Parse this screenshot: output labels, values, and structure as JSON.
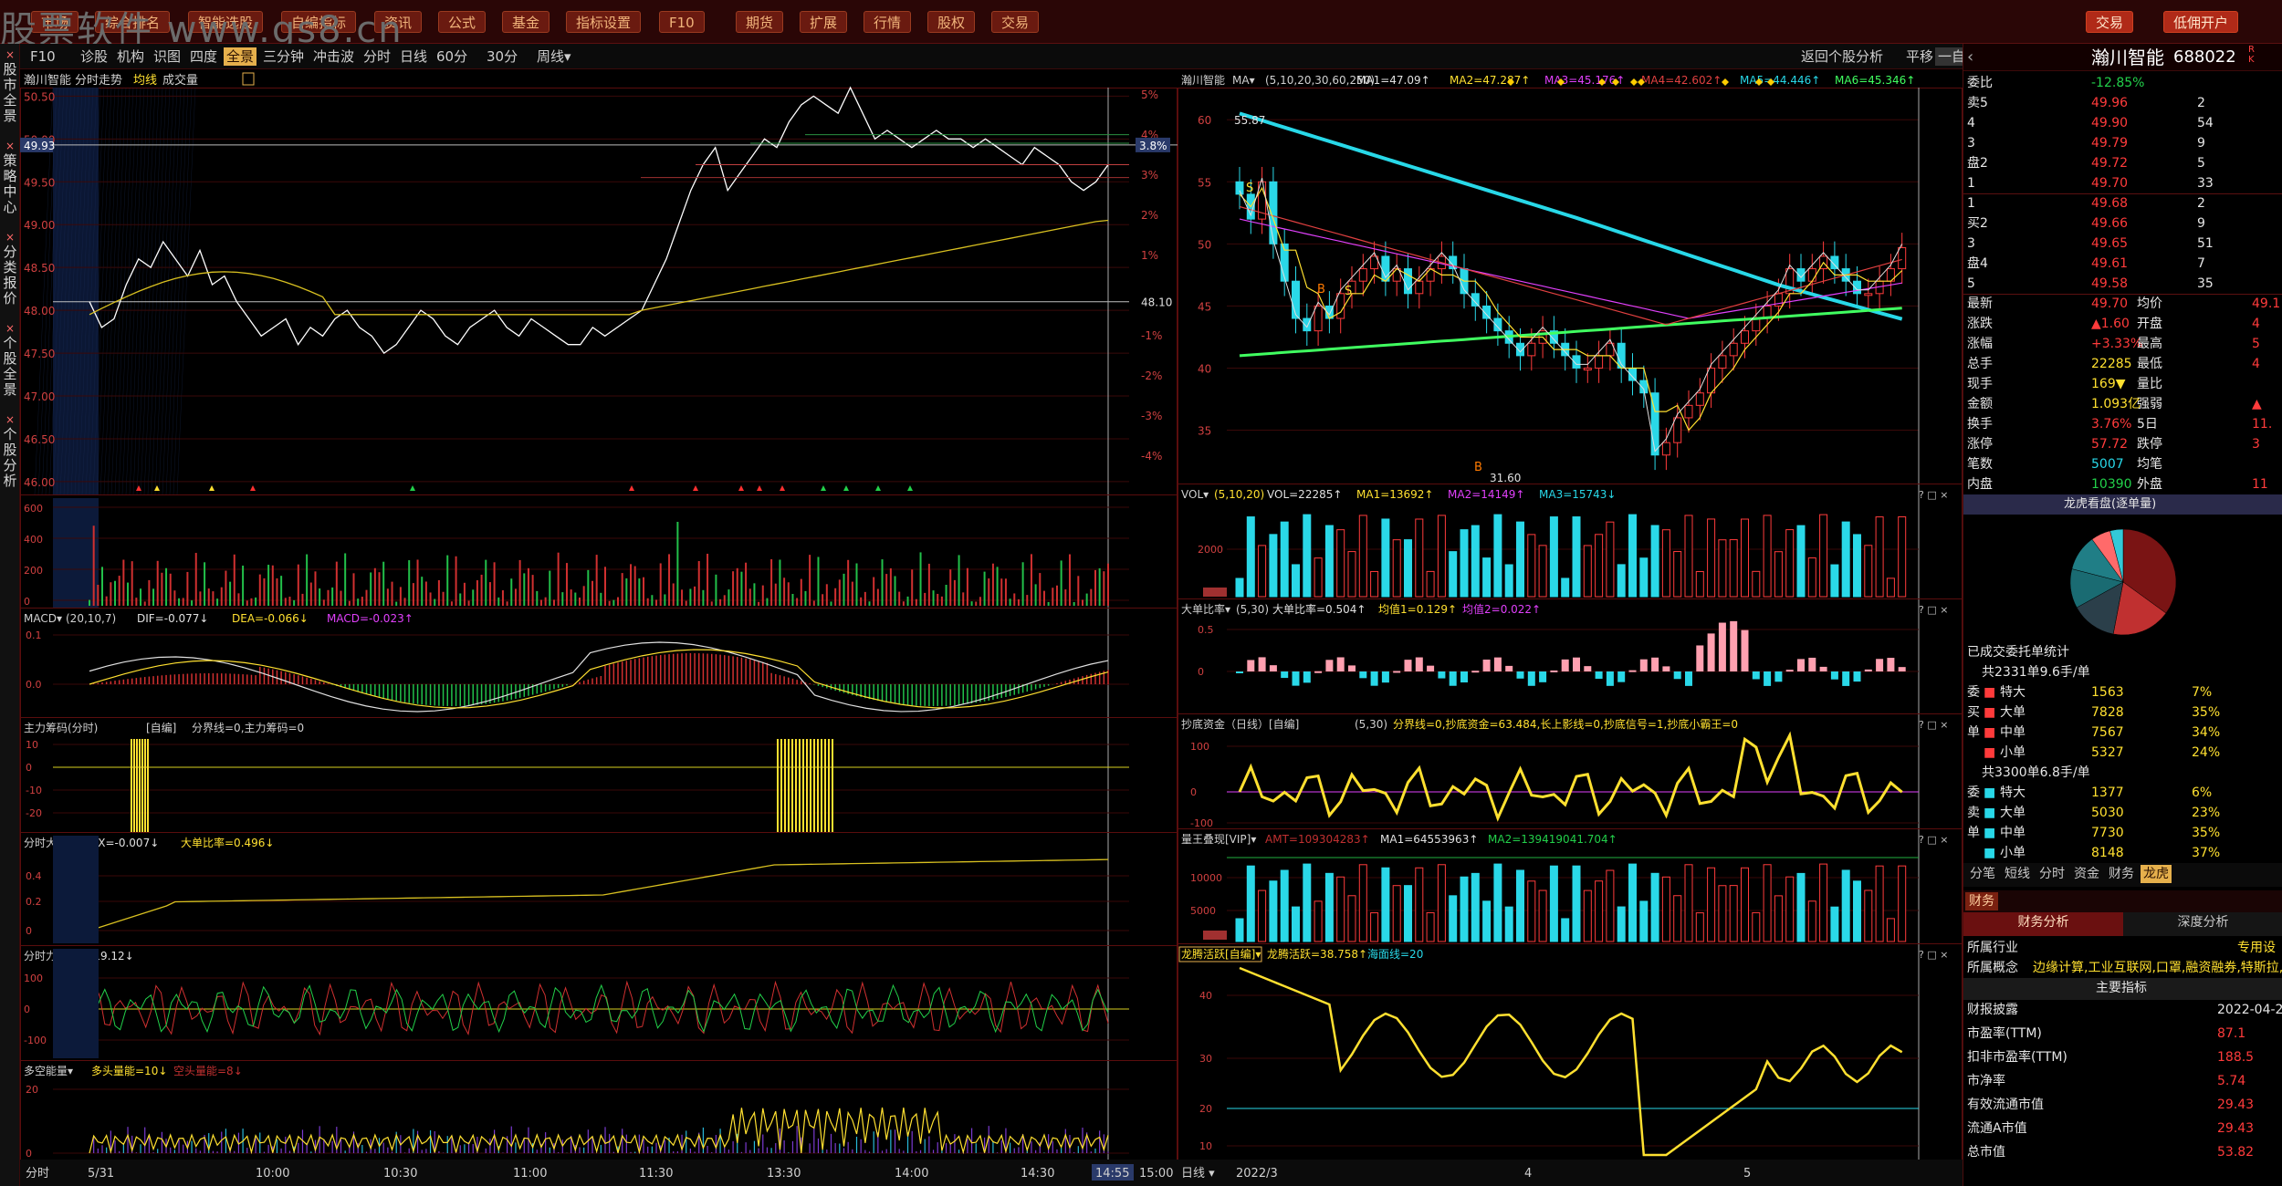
{
  "top": {
    "watermark": "股票软件 www.gs8.cn",
    "menu": [
      "市场",
      "综合排名",
      "智能选股",
      "自编指标",
      "资讯",
      "公式",
      "基金",
      "指标设置",
      "F10",
      "期货",
      "扩展",
      "行情",
      "股权",
      "交易"
    ],
    "trade": "交易",
    "open_account": "低佣开户"
  },
  "sidenav": [
    "股市全景",
    "策略中心",
    "分类报价",
    "个股全景",
    "个股分析"
  ],
  "tabs": [
    "F10",
    "诊股",
    "机构",
    "识图",
    "四度",
    "全景",
    "三分钟",
    "冲击波",
    "分时",
    "日线",
    "60分",
    "30分",
    "周线▾"
  ],
  "right_tabs": {
    "return": "返回个股分析",
    "flat": "平移",
    "select": "一自选"
  },
  "intraday": {
    "header": {
      "name": "瀚川智能",
      "mode": "分时走势",
      "avg": "均线",
      "vol": "成交量"
    },
    "price_ticks": [
      "50.50",
      "50.00",
      "49.50",
      "49.00",
      "48.50",
      "48.00",
      "47.50",
      "47.00",
      "46.50",
      "46.00"
    ],
    "pct_ticks": [
      "5%",
      "4%",
      "3%",
      "2%",
      "1%",
      "",
      "-1%",
      "-2%",
      "-3%",
      "-4%"
    ],
    "cursor_price": "49.93",
    "cursor_pct": "3.8%",
    "mid_label": "48.10",
    "time_ticks": [
      "分时",
      "5/31",
      "10:00",
      "10:30",
      "11:00",
      "11:30",
      "13:30",
      "14:00",
      "14:30",
      "14:55",
      "15:00"
    ],
    "vol_ticks": [
      "600",
      "400",
      "200",
      "0"
    ],
    "macd": {
      "name": "MACD",
      "params": "(20,10,7)",
      "dif": "DIF=-0.077",
      "dea": "DEA=-0.066",
      "macd": "MACD=-0.023"
    },
    "chip": {
      "name": "主力筹码(分时)",
      "mode": "[自编]",
      "text": "分界线=0,主力筹码=0"
    },
    "big": {
      "name": "分时大单",
      "dx": "DX=-0.007",
      "ratio": "大单比率=0.496"
    },
    "force": {
      "name": "分时力道",
      "val": "-19.12"
    },
    "energy": {
      "name": "多空能量",
      "long": "多头量能=10",
      "short": "空头量能=8"
    }
  },
  "daily": {
    "header": {
      "name": "瀚川智能",
      "ma": "MA",
      "params": "(5,10,20,30,60,250)",
      "ma1": "MA1=47.09",
      "ma2": "MA2=47.287",
      "ma3": "MA3=45.176",
      "ma4": "MA4=42.602",
      "ma5": "MA5=44.446",
      "ma6": "MA6=45.346"
    },
    "price_ticks": [
      "60",
      "55",
      "50",
      "45",
      "40",
      "35"
    ],
    "hi_label": "55.87",
    "lo_label": "31.60",
    "vol": {
      "name": "VOL",
      "params": "(5,10,20)",
      "v": "VOL=22285",
      "ma1": "MA1=13692",
      "ma2": "MA2=14149",
      "ma3": "MA3=15743"
    },
    "big": {
      "name": "大单比率",
      "params": "(5,30)",
      "v": "大单比率=0.504",
      "j1": "均值1=0.129",
      "j2": "均值2=0.022"
    },
    "bottom": {
      "name": "抄底资金（日线）[自编]",
      "params": "(5,30)",
      "text": "分界线=0,抄底资金=63.484,长上影线=0,抄底信号=1,抄底小霸王=0"
    },
    "amount": {
      "name": "量王叠现[VIP]",
      "amt": "AMT=109304283",
      "ma1": "MA1=64553963",
      "ma2": "MA2=139419041.704"
    },
    "active": {
      "name": "龙腾活跃[自编]",
      "v": "龙腾活跃=38.758",
      "line": "海面线=20"
    },
    "time_ticks": [
      "日线",
      "2022/3",
      "4",
      "5"
    ]
  },
  "quote": {
    "name": "瀚川智能",
    "code": "688022",
    "webi": {
      "label": "委比",
      "val": "-12.85%"
    },
    "sell": [
      {
        "l": "卖5",
        "p": "49.96",
        "v": "2"
      },
      {
        "l": "4",
        "p": "49.90",
        "v": "54"
      },
      {
        "l": "3",
        "p": "49.79",
        "v": "9"
      },
      {
        "l": "盘2",
        "p": "49.72",
        "v": "5"
      },
      {
        "l": "1",
        "p": "49.70",
        "v": "33"
      }
    ],
    "buy": [
      {
        "l": "1",
        "p": "49.68",
        "v": "2"
      },
      {
        "l": "买2",
        "p": "49.66",
        "v": "9"
      },
      {
        "l": "3",
        "p": "49.65",
        "v": "51"
      },
      {
        "l": "盘4",
        "p": "49.61",
        "v": "7"
      },
      {
        "l": "5",
        "p": "49.58",
        "v": "35"
      }
    ],
    "stats": [
      {
        "a": "最新",
        "b": "49.70",
        "c": "均价",
        "d": "49.1"
      },
      {
        "a": "涨跌",
        "b": "▲1.60",
        "c": "开盘",
        "d": "4"
      },
      {
        "a": "涨幅",
        "b": "+3.33%",
        "c": "最高",
        "d": "5"
      },
      {
        "a": "总手",
        "b": "22285",
        "c": "最低",
        "d": "4"
      },
      {
        "a": "现手",
        "b": "169▼",
        "c": "量比",
        "d": ""
      },
      {
        "a": "金额",
        "b": "1.093亿",
        "c": "强弱",
        "d": "▲"
      },
      {
        "a": "换手",
        "b": "3.76%",
        "c": "5日",
        "d": "11."
      },
      {
        "a": "涨停",
        "b": "57.72",
        "c": "跌停",
        "d": "3"
      },
      {
        "a": "笔数",
        "b": "5007",
        "c": "均笔",
        "d": ""
      },
      {
        "a": "内盘",
        "b": "10390",
        "c": "外盘",
        "d": "11"
      }
    ],
    "pie_title": "龙虎看盘(逐单量)",
    "pie_slices": [
      35,
      18,
      14,
      12,
      11,
      6,
      4
    ],
    "pie_colors": [
      "#7a1414",
      "#c03030",
      "#2b3f4a",
      "#1a6b72",
      "#207e86",
      "#ff6a6a",
      "#33c9d8"
    ],
    "order_title": "已成交委托单统计",
    "buy_total": "共2331单9.6手/单",
    "buy_rows": [
      {
        "s": "委",
        "t": "特大",
        "v": "1563",
        "p": "7%"
      },
      {
        "s": "买",
        "t": "大单",
        "v": "7828",
        "p": "35%"
      },
      {
        "s": "单",
        "t": "中单",
        "v": "7567",
        "p": "34%"
      },
      {
        "s": "",
        "t": "小单",
        "v": "5327",
        "p": "24%"
      }
    ],
    "sell_total": "共3300单6.8手/单",
    "sell_rows": [
      {
        "s": "委",
        "t": "特大",
        "v": "1377",
        "p": "6%"
      },
      {
        "s": "卖",
        "t": "大单",
        "v": "5030",
        "p": "23%"
      },
      {
        "s": "单",
        "t": "中单",
        "v": "7730",
        "p": "35%"
      },
      {
        "s": "",
        "t": "小单",
        "v": "8148",
        "p": "37%"
      }
    ],
    "subtabs": [
      "分笔",
      "短线",
      "分时",
      "资金",
      "财务",
      "龙虎"
    ],
    "fin_tab": "财务",
    "fin_sub": [
      "财务分析",
      "深度分析"
    ],
    "industry": {
      "l": "所属行业",
      "v": "专用设"
    },
    "concept": {
      "l": "所属概念",
      "v": "边缘计算,工业互联网,口罩,融资融券,特斯拉,无"
    },
    "main_title": "主要指标",
    "fin_rows": [
      {
        "l": "财报披露",
        "v": "2022-04-27"
      },
      {
        "l": "市盈率(TTM)",
        "v": "87.1"
      },
      {
        "l": "扣非市盈率(TTM)",
        "v": "188.5"
      },
      {
        "l": "市净率",
        "v": "5.74"
      },
      {
        "l": "有效流通市值",
        "v": "29.43"
      },
      {
        "l": "流通A市值",
        "v": "29.43"
      },
      {
        "l": "总市值",
        "v": "53.82"
      }
    ]
  }
}
